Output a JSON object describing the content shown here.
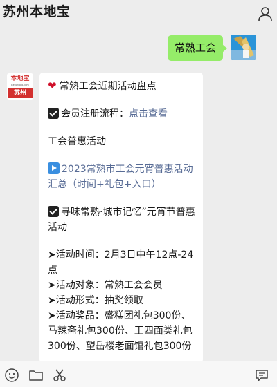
{
  "header": {
    "title": "苏州本地宝",
    "profile_icon": "person-icon"
  },
  "messages": {
    "outgoing": {
      "text": "常熟工会"
    },
    "incoming": {
      "avatar": {
        "brand": "本地宝",
        "url": "BenDiBao.com",
        "city": "苏州"
      },
      "heading": "常熟工会近期活动盘点",
      "register_label": "会员注册流程：",
      "register_link": "点击查看",
      "section_title": "工会普惠活动",
      "article_link": "2023常熟市工会元宵普惠活动汇总（时间+礼包+入口）",
      "event_title": "寻味常熟·城市记忆”元宵节普惠活动",
      "details": [
        "➤活动时间：2月3日中午12点-24点",
        "➤活动对象：常熟工会会员",
        "➤活动形式：抽奖领取",
        "➤活动奖品：盛糕团礼包300份、马辣斋礼包300份、王四面类礼包300份、望岳楼老面馆礼包300份"
      ]
    }
  },
  "toolbar": {
    "icons": [
      "emoji-icon",
      "folder-icon",
      "scissors-icon",
      "chat-icon"
    ]
  },
  "colors": {
    "background": "#ededed",
    "outgoing_bubble": "#95ec69",
    "link": "#576b95",
    "brand_red": "#d3302f"
  }
}
